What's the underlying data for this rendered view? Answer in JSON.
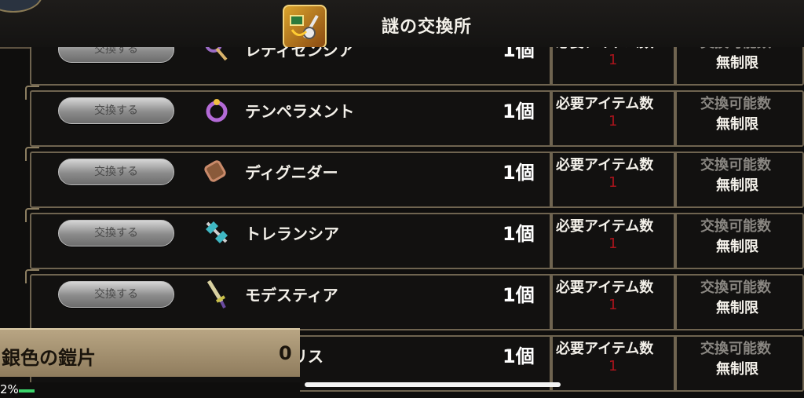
{
  "header": {
    "title": "謎の交換所"
  },
  "exchange_button_label": "交換する",
  "rows": [
    {
      "name": "レティセンシア",
      "quantity": "1個",
      "required_label": "必要アイテム数",
      "required_value": "1",
      "available_label": "交換可能数",
      "available_value": "無制限",
      "icon": "staff-icon",
      "color": "#9a6bc4"
    },
    {
      "name": "テンペラメント",
      "quantity": "1個",
      "required_label": "必要アイテム数",
      "required_value": "1",
      "available_label": "交換可能数",
      "available_value": "無制限",
      "icon": "ring-icon",
      "color": "#b36ad6"
    },
    {
      "name": "ディグニダー",
      "quantity": "1個",
      "required_label": "必要アイテム数",
      "required_value": "1",
      "available_label": "交換可能数",
      "available_value": "無制限",
      "icon": "gauntlet-icon",
      "color": "#c98a6a"
    },
    {
      "name": "トレランシア",
      "quantity": "1個",
      "required_label": "必要アイテム数",
      "required_value": "1",
      "available_label": "交換可能数",
      "available_value": "無制限",
      "icon": "axe-icon",
      "color": "#3fb8c4"
    },
    {
      "name": "モデスティア",
      "quantity": "1個",
      "required_label": "必要アイテム数",
      "required_value": "1",
      "available_label": "交換可能数",
      "available_value": "無制限",
      "icon": "sword-icon",
      "color": "#c9c04a"
    },
    {
      "name": "ミスタリス",
      "quantity": "1個",
      "required_label": "必要アイテム数",
      "required_value": "1",
      "available_label": "交換可能数",
      "available_value": "無制限",
      "icon": "orb-icon",
      "color": "#8bc24a"
    }
  ],
  "currency": {
    "name": "銀色の鎧片",
    "count": "0"
  },
  "progress": {
    "text": "2%",
    "value": 0.02
  }
}
